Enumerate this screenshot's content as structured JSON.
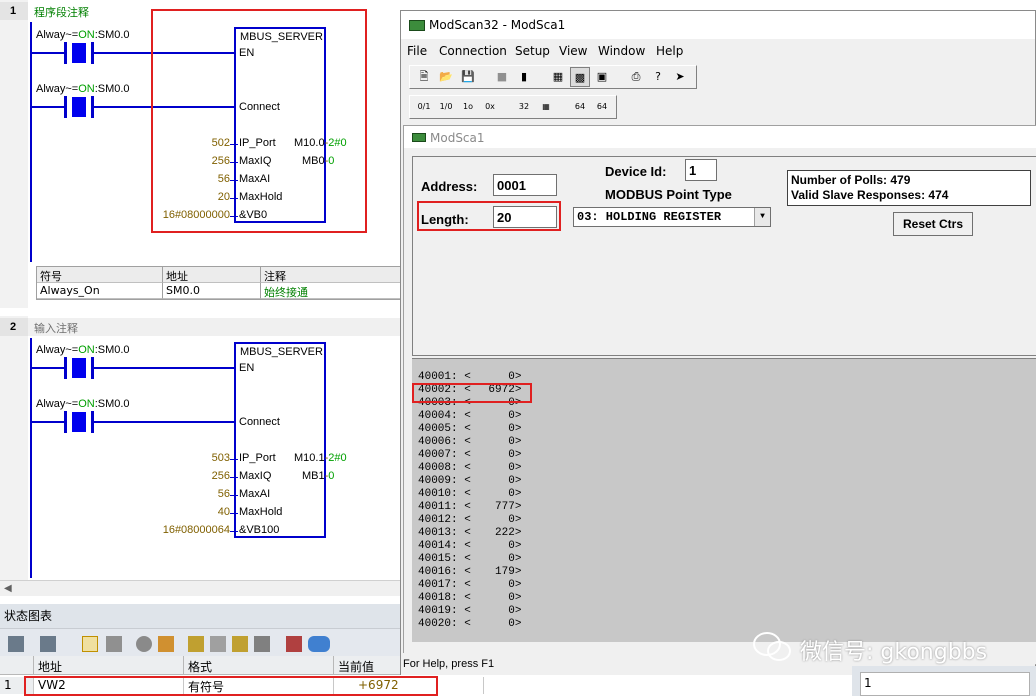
{
  "ladder": {
    "networks": [
      {
        "number": "1",
        "comment": "程序段注释",
        "contacts": [
          {
            "prefix": "Alway~=",
            "on": "ON",
            "addr": ":SM0.0"
          },
          {
            "prefix": "Alway~=",
            "on": "ON",
            "addr": ":SM0.0"
          }
        ],
        "block": {
          "title": "MBUS_SERVER",
          "pins": [
            "EN",
            "Connect",
            "IP_Port",
            "MaxIQ",
            "MaxAI",
            "MaxHold",
            "&VB0"
          ],
          "inputs": [
            "502",
            "256",
            "56",
            "20",
            "16#08000000"
          ],
          "outputs": [
            {
              "name": "M10.0",
              "value": "2#0"
            },
            {
              "name": "MB0",
              "value": "0"
            }
          ]
        }
      },
      {
        "number": "2",
        "comment": "输入注释",
        "contacts": [
          {
            "prefix": "Alway~=",
            "on": "ON",
            "addr": ":SM0.0"
          },
          {
            "prefix": "Alway~=",
            "on": "ON",
            "addr": ":SM0.0"
          }
        ],
        "block": {
          "title": "MBUS_SERVER",
          "pins": [
            "EN",
            "Connect",
            "IP_Port",
            "MaxIQ",
            "MaxAI",
            "MaxHold",
            "&VB100"
          ],
          "inputs": [
            "503",
            "256",
            "56",
            "40",
            "16#08000064"
          ],
          "outputs": [
            {
              "name": "M10.1",
              "value": "2#0"
            },
            {
              "name": "MB1",
              "value": "0"
            }
          ]
        }
      }
    ],
    "symbol_table": {
      "headers": [
        "符号",
        "地址",
        "注释"
      ],
      "rows": [
        [
          "Always_On",
          "SM0.0",
          "始终接通"
        ]
      ]
    }
  },
  "status_chart": {
    "title": "状态图表",
    "headers": [
      "地址",
      "格式",
      "当前值"
    ],
    "rows": [
      {
        "index": "1",
        "address": "VW2",
        "format": "有符号",
        "value": "+6972"
      }
    ]
  },
  "modscan": {
    "title": "ModScan32 - ModSca1",
    "menu": [
      "File",
      "Connection",
      "Setup",
      "View",
      "Window",
      "Help"
    ],
    "child_title": "ModSca1",
    "address_label": "Address:",
    "address_value": "0001",
    "length_label": "Length:",
    "length_value": "20",
    "device_id_label": "Device Id:",
    "device_id_value": "1",
    "point_type_label": "MODBUS Point Type",
    "point_type_value": "03: HOLDING REGISTER",
    "polls_line": "Number of Polls: 479",
    "responses_line": "Valid Slave Responses: 474",
    "reset_label": "Reset Ctrs",
    "registers": [
      {
        "addr": "40001",
        "value": "0"
      },
      {
        "addr": "40002",
        "value": "6972"
      },
      {
        "addr": "40003",
        "value": "0"
      },
      {
        "addr": "40004",
        "value": "0"
      },
      {
        "addr": "40005",
        "value": "0"
      },
      {
        "addr": "40006",
        "value": "0"
      },
      {
        "addr": "40007",
        "value": "0"
      },
      {
        "addr": "40008",
        "value": "0"
      },
      {
        "addr": "40009",
        "value": "0"
      },
      {
        "addr": "40010",
        "value": "0"
      },
      {
        "addr": "40011",
        "value": "777"
      },
      {
        "addr": "40012",
        "value": "0"
      },
      {
        "addr": "40013",
        "value": "222"
      },
      {
        "addr": "40014",
        "value": "0"
      },
      {
        "addr": "40015",
        "value": "0"
      },
      {
        "addr": "40016",
        "value": "179"
      },
      {
        "addr": "40017",
        "value": "0"
      },
      {
        "addr": "40018",
        "value": "0"
      },
      {
        "addr": "40019",
        "value": "0"
      },
      {
        "addr": "40020",
        "value": "0"
      }
    ],
    "status_bar": "For Help, press F1",
    "toolbar1": [
      "new-icon",
      "open-icon",
      "save-icon",
      "connect-icon",
      "disconnect-icon",
      "display-icon",
      "graph-icon",
      "monitor-icon",
      "print-icon",
      "help-icon",
      "context-help-icon"
    ],
    "toolbar2": [
      "coil-icon",
      "input-icon",
      "holding-icon",
      "decimal-icon",
      "32bit-icon",
      "float-icon",
      "64bit-icon",
      "double-icon"
    ]
  },
  "watermark": "微信号: gkongbbs",
  "corner_row": "1",
  "colors": {
    "rung": "#0000cc",
    "highlight_box": "#e02020",
    "on_text": "#00a000",
    "data_panel": "#c8c8c8"
  }
}
